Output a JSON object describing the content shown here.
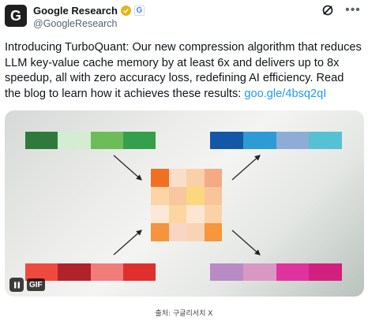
{
  "tweet": {
    "avatar_letter": "G",
    "display_name": "Google Research",
    "badge_letter": "G",
    "handle": "@GoogleResearch",
    "text": "Introducing TurboQuant: Our new compression algorithm that reduces LLM key-value cache memory by at least 6x and delivers up to 8x speedup, all with zero accuracy loss, redefining AI efficiency. Read the blog to learn how it achieves these results: ",
    "link_text": "goo.gle/4bsq2qI",
    "icons": [
      "grok-icon",
      "more-dots-icon"
    ]
  },
  "media": {
    "gif_label": "GIF",
    "colors": {
      "green_bar": [
        "#2f7a3b",
        "#d4ecd2",
        "#6cbd5a",
        "#35a04b"
      ],
      "blue_bar": [
        "#1457a7",
        "#2e9ad6",
        "#8eadd6",
        "#56c1d2"
      ],
      "red_bar": [
        "#ef4a3f",
        "#b0232a",
        "#f07d7a",
        "#e0302d"
      ],
      "pink_bar": [
        "#b98bc4",
        "#d998c4",
        "#e0339d",
        "#d2207f"
      ],
      "grid": [
        "#f07021",
        "#fadec8",
        "#f9d0a8",
        "#f6a985",
        "#fcd4a6",
        "#f8c7a0",
        "#fbd77e",
        "#f8c49a",
        "#fbe8d6",
        "#fcd69e",
        "#fbe6d2",
        "#fbd2a8",
        "#f5933e",
        "#f9d6c4",
        "#f9d4b4",
        "#f7963b"
      ]
    }
  },
  "caption": "출처: 구글리서치 X"
}
